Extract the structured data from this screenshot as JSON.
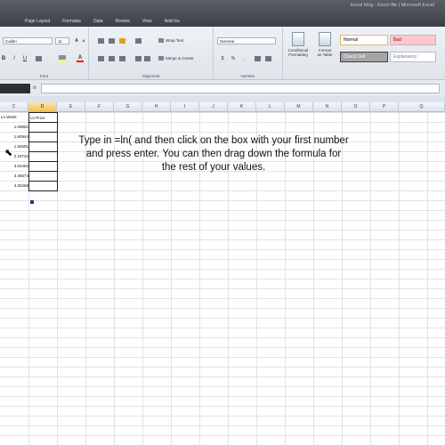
{
  "window": {
    "title": "Excel blog - Excel file | Microsoft Excel",
    "tabs": [
      "",
      "Page Layout",
      "Formulas",
      "Data",
      "Review",
      "View",
      "Add-Ins"
    ]
  },
  "ribbon": {
    "font_name": "Calibri",
    "font_size": "11",
    "wrap_text": "Wrap Text",
    "merge_center": "Merge & Center",
    "number_format": "General",
    "conditional_formatting": "Conditional\nFormatting",
    "format_as_table": "Format\nas Table",
    "style_normal": "Normal",
    "style_bad": "Bad",
    "style_check_cell": "Check Cell",
    "style_explanatory": "Explanatory",
    "groups": {
      "font": "Font",
      "alignment": "Alignment",
      "number": "Number"
    }
  },
  "formula_bar": {
    "name_box": "",
    "fx": "fx",
    "value": ""
  },
  "grid": {
    "columns": [
      "C",
      "D",
      "E",
      "F",
      "G",
      "H",
      "I",
      "J",
      "K",
      "L",
      "M",
      "N",
      "O",
      "P",
      "Q"
    ],
    "selected_column": "D",
    "cells_c": [
      "Ln Week",
      "1.09861",
      "1.60944",
      "1.94591",
      "2.19722",
      "3.04452",
      "3.46574",
      "4.26268"
    ],
    "cells_d": [
      "Ln Price",
      "",
      "",
      "",
      "",
      "",
      "",
      ""
    ]
  },
  "instruction": {
    "line1": "Type in =ln( and then click on the box with your first number",
    "line2": "and press enter. You can then drag down the formula for",
    "line3": "the rest of your values."
  },
  "colors": {
    "accent_selected_column": "#f2c45a",
    "style_normal_bg": "#ffffff",
    "style_bad_bg": "#ffc7ce",
    "style_check_bg": "#a5a5a5"
  }
}
